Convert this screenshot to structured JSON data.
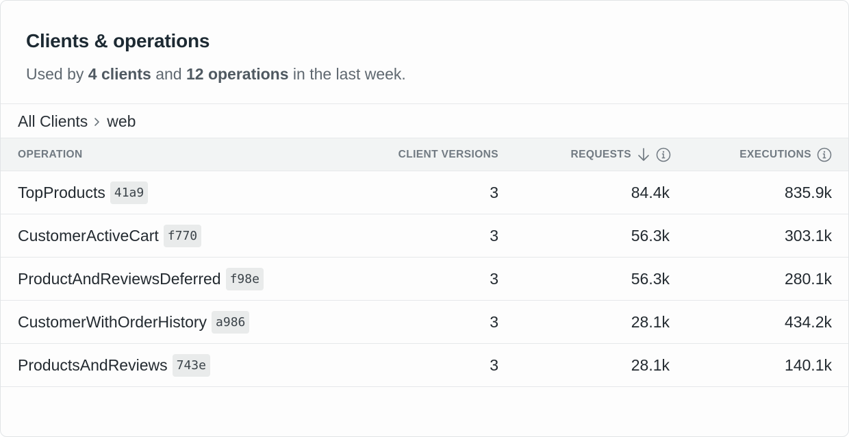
{
  "header": {
    "title": "Clients & operations",
    "subtitle": {
      "prefix": "Used by",
      "clients": "4 clients",
      "middle": "and",
      "operations": "12 operations",
      "suffix": "in the last week."
    }
  },
  "breadcrumb": {
    "root": "All Clients",
    "current": "web"
  },
  "table": {
    "columns": {
      "operation": "OPERATION",
      "client_versions": "CLIENT VERSIONS",
      "requests": "REQUESTS",
      "executions": "EXECUTIONS"
    },
    "sort": {
      "column": "requests",
      "direction": "descending",
      "icon": "arrow-down-icon"
    },
    "rows": [
      {
        "name": "TopProducts",
        "hash": "41a9",
        "client_versions": "3",
        "requests": "84.4k",
        "executions": "835.9k"
      },
      {
        "name": "CustomerActiveCart",
        "hash": "f770",
        "client_versions": "3",
        "requests": "56.3k",
        "executions": "303.1k"
      },
      {
        "name": "ProductAndReviewsDeferred",
        "hash": "f98e",
        "client_versions": "3",
        "requests": "56.3k",
        "executions": "280.1k"
      },
      {
        "name": "CustomerWithOrderHistory",
        "hash": "a986",
        "client_versions": "3",
        "requests": "28.1k",
        "executions": "434.2k"
      },
      {
        "name": "ProductsAndReviews",
        "hash": "743e",
        "client_versions": "3",
        "requests": "28.1k",
        "executions": "140.1k"
      }
    ]
  }
}
